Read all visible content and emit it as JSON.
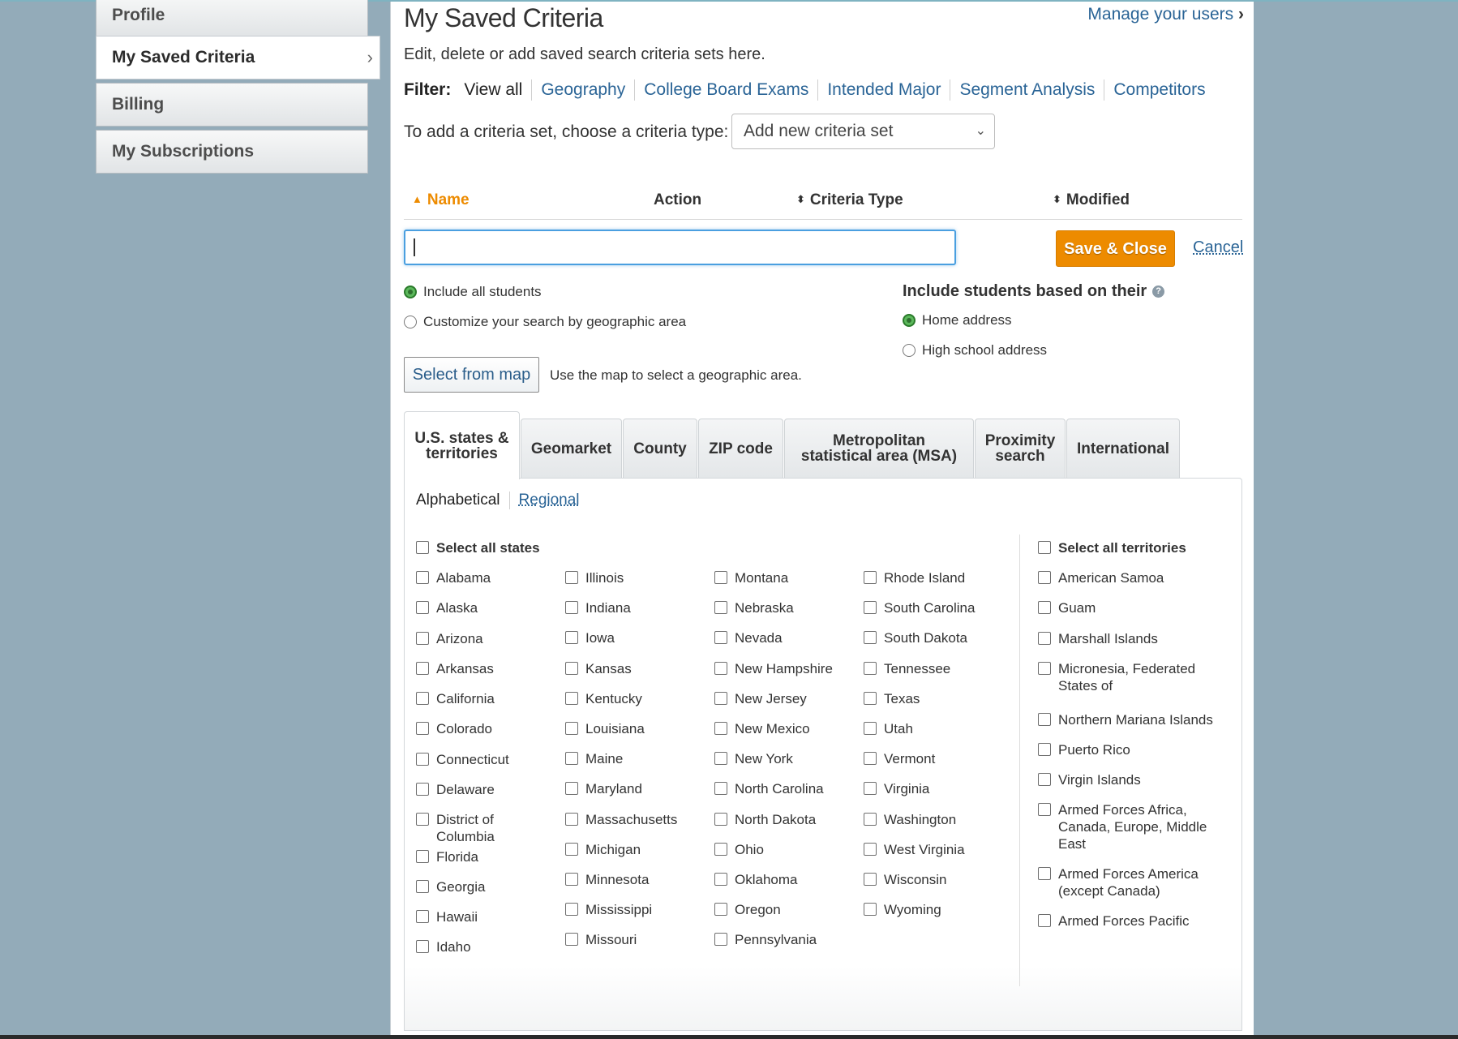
{
  "sidebar": {
    "items": [
      {
        "label": "Profile"
      },
      {
        "label": "My Saved Criteria"
      },
      {
        "label": "Billing"
      },
      {
        "label": "My Subscriptions"
      }
    ]
  },
  "header": {
    "title": "My Saved Criteria",
    "manage_link": "Manage your users",
    "description": "Edit, delete or add saved search criteria sets here."
  },
  "filter": {
    "label": "Filter:",
    "items": [
      "View all",
      "Geography",
      "College Board Exams",
      "Intended Major",
      "Segment Analysis",
      "Competitors"
    ],
    "selected": "View all"
  },
  "add_set": {
    "label": "To add a criteria set, choose a criteria type:",
    "selected": "Add new criteria set"
  },
  "table": {
    "columns": {
      "name": "Name",
      "action": "Action",
      "type": "Criteria Type",
      "modified": "Modified"
    }
  },
  "editor": {
    "name_value": "",
    "save_label": "Save & Close",
    "cancel_label": "Cancel",
    "scope_options": [
      {
        "label": "Include all students",
        "checked": true
      },
      {
        "label": "Customize your search by geographic area",
        "checked": false
      }
    ],
    "based_on_heading": "Include students based on their",
    "based_on_options": [
      {
        "label": "Home address",
        "checked": true
      },
      {
        "label": "High school address",
        "checked": false
      }
    ],
    "map_button": "Select from map",
    "map_hint": "Use the map to select a geographic area."
  },
  "tabs": [
    {
      "label": "U.S. states & territories",
      "active": true
    },
    {
      "label": "Geomarket"
    },
    {
      "label": "County"
    },
    {
      "label": "ZIP code"
    },
    {
      "label": "Metropolitan statistical area (MSA)"
    },
    {
      "label": "Proximity search"
    },
    {
      "label": "International"
    }
  ],
  "subfilter": {
    "alphabetical": "Alphabetical",
    "regional": "Regional"
  },
  "states": {
    "select_all": "Select all states",
    "columns": [
      [
        "Alabama",
        "Alaska",
        "Arizona",
        "Arkansas",
        "California",
        "Colorado",
        "Connecticut",
        "Delaware",
        "District of Columbia",
        "Florida",
        "Georgia",
        "Hawaii",
        "Idaho"
      ],
      [
        "Illinois",
        "Indiana",
        "Iowa",
        "Kansas",
        "Kentucky",
        "Louisiana",
        "Maine",
        "Maryland",
        "Massachusetts",
        "Michigan",
        "Minnesota",
        "Mississippi",
        "Missouri"
      ],
      [
        "Montana",
        "Nebraska",
        "Nevada",
        "New Hampshire",
        "New Jersey",
        "New Mexico",
        "New York",
        "North Carolina",
        "North Dakota",
        "Ohio",
        "Oklahoma",
        "Oregon",
        "Pennsylvania"
      ],
      [
        "Rhode Island",
        "South Carolina",
        "South Dakota",
        "Tennessee",
        "Texas",
        "Utah",
        "Vermont",
        "Virginia",
        "Washington",
        "West Virginia",
        "Wisconsin",
        "Wyoming"
      ]
    ]
  },
  "territories": {
    "select_all": "Select all territories",
    "items": [
      "American Samoa",
      "Guam",
      "Marshall Islands",
      "Micronesia, Federated States of",
      "Northern Mariana Islands",
      "Puerto Rico",
      "Virgin Islands",
      "Armed Forces Africa, Canada, Europe, Middle East",
      "Armed Forces America (except Canada)",
      "Armed Forces Pacific"
    ]
  },
  "colors": {
    "accent": "#ed8b00",
    "link": "#2a6496",
    "background": "#93abb9"
  }
}
